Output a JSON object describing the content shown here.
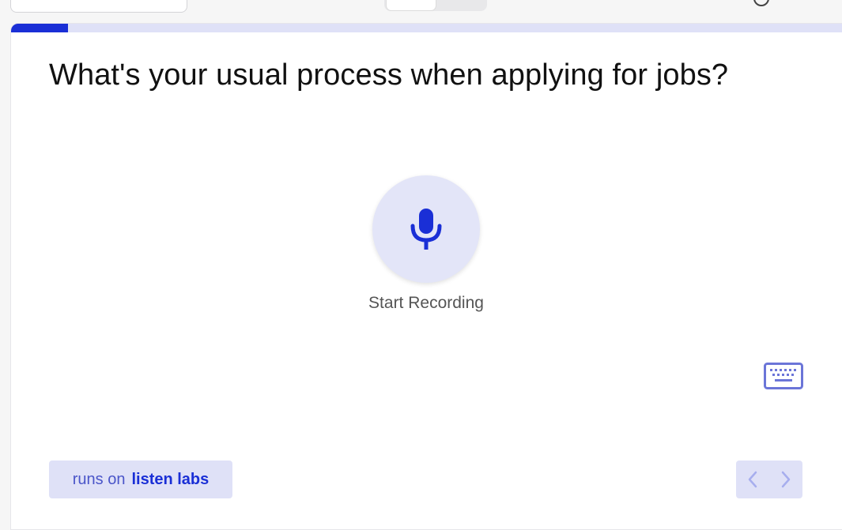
{
  "progress": {
    "fraction": 0.068
  },
  "question": {
    "text": "What's your usual process when applying for jobs?"
  },
  "recorder": {
    "label": "Start Recording",
    "icon": "microphone-icon"
  },
  "footer": {
    "runs_on_prefix": "runs on",
    "brand": "listen labs"
  },
  "navigation": {
    "prev_icon": "chevron-left-icon",
    "next_icon": "chevron-right-icon"
  },
  "keyboard": {
    "icon": "keyboard-icon"
  },
  "colors": {
    "accent": "#1a2fd6",
    "accent_light": "#dfe1f7",
    "mic_bg": "#e3e5f8",
    "keyboard_icon": "#6b75d8",
    "nav_chevron": "#a7aeee"
  }
}
